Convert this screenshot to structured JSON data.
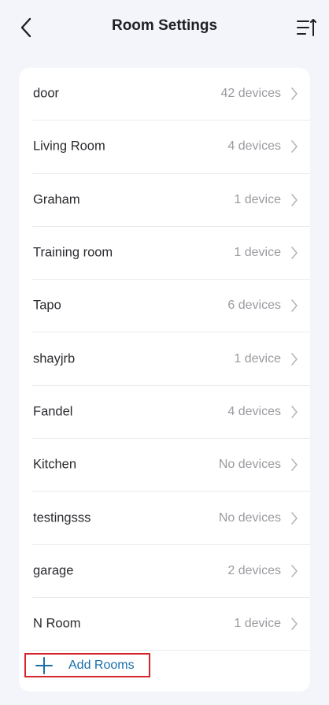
{
  "header": {
    "title": "Room Settings",
    "back_icon": "chevron-left-icon",
    "sort_icon": "sort-list-icon"
  },
  "rooms": [
    {
      "name": "door",
      "count": "42 devices"
    },
    {
      "name": "Living Room",
      "count": "4 devices"
    },
    {
      "name": "Graham",
      "count": "1 device"
    },
    {
      "name": "Training room",
      "count": "1 device"
    },
    {
      "name": "Tapo",
      "count": "6 devices"
    },
    {
      "name": "shayjrb",
      "count": "1 device"
    },
    {
      "name": "Fandel",
      "count": "4 devices"
    },
    {
      "name": "Kitchen",
      "count": "No devices"
    },
    {
      "name": "testingsss",
      "count": "No devices"
    },
    {
      "name": "garage",
      "count": "2 devices"
    },
    {
      "name": "N Room",
      "count": "1 device"
    }
  ],
  "add_button": {
    "label": "Add Rooms",
    "icon": "plus-icon"
  },
  "colors": {
    "background": "#f4f5fa",
    "card": "#ffffff",
    "accent": "#1b6fa8",
    "highlight_border": "#d6242c",
    "muted_text": "#9a9ba0"
  }
}
